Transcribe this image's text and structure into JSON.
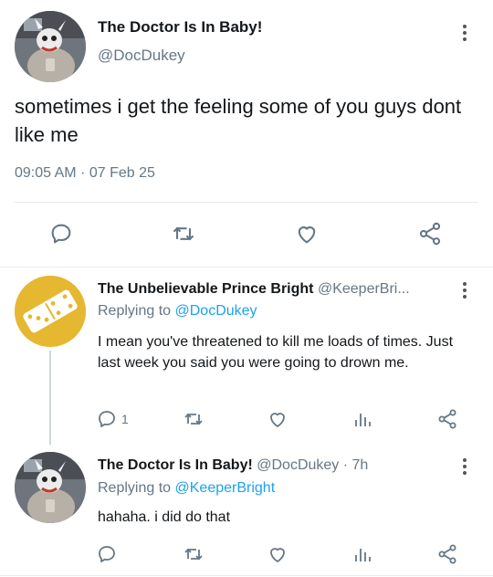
{
  "main_tweet": {
    "display_name": "The Doctor Is In Baby!",
    "handle": "@DocDukey",
    "text": "sometimes i get the feeling some of you guys dont like me",
    "timestamp": "09:05 AM · 07 Feb 25",
    "actions": [
      "reply-icon",
      "retweet-icon",
      "like-icon",
      "share-icon"
    ]
  },
  "replies": [
    {
      "display_name": "The Unbelievable Prince Bright",
      "handle_trunc": "@KeeperBri...",
      "replying_prefix": "Replying to ",
      "replying_to": "@DocDukey",
      "text": "I mean you've threatened to kill me loads of times. Just last week you said you were going to drown me.",
      "reply_count": "1",
      "avatar_icon": "domino-icon",
      "avatar_color": "#e6b731"
    },
    {
      "display_name": "The Doctor Is In Baby!",
      "handle": "@DocDukey",
      "time": "· 7h",
      "replying_prefix": "Replying to ",
      "replying_to": "@KeeperBright",
      "text": "hahaha. i did do that",
      "avatar_icon": "robot-dog-icon"
    }
  ],
  "colors": {
    "link": "#1da1f2",
    "secondary_text": "#657786",
    "icon_gray": "#657786"
  }
}
